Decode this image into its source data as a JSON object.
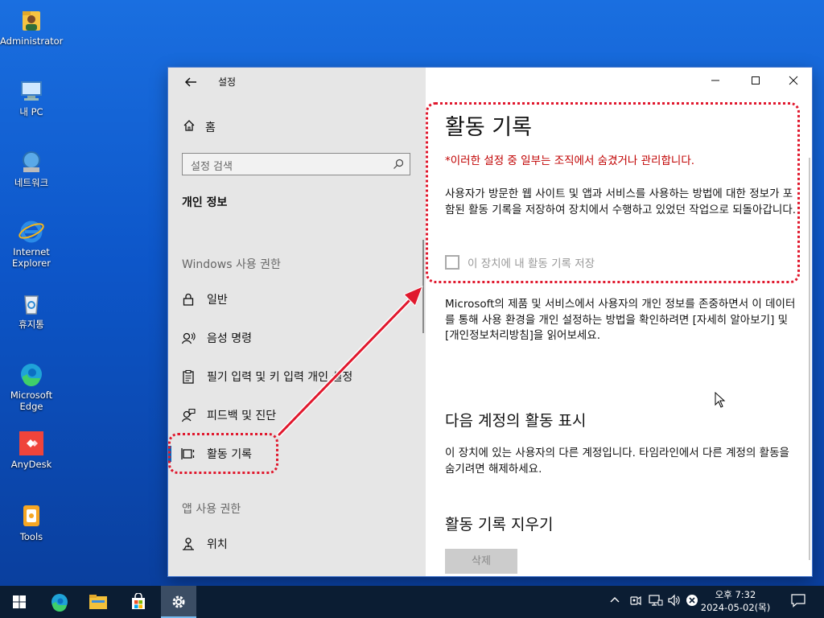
{
  "desktop": {
    "icons": [
      {
        "label": "Administrator",
        "icon": "user-folder-icon"
      },
      {
        "label": "내 PC",
        "icon": "computer-icon"
      },
      {
        "label": "네트워크",
        "icon": "network-icon"
      },
      {
        "label": "Internet Explorer",
        "icon": "internet-explorer-icon"
      },
      {
        "label": "휴지통",
        "icon": "recycle-bin-icon"
      },
      {
        "label": "Microsoft Edge",
        "icon": "edge-icon"
      },
      {
        "label": "AnyDesk",
        "icon": "anydesk-icon"
      },
      {
        "label": "Tools",
        "icon": "tools-icon"
      }
    ]
  },
  "window": {
    "title": "설정",
    "sidebar": {
      "home": "홈",
      "search_placeholder": "설정 검색",
      "section": "개인 정보",
      "group_windows": "Windows 사용 권한",
      "items": [
        {
          "label": "일반",
          "icon": "lock-icon"
        },
        {
          "label": "음성 명령",
          "icon": "speech-icon"
        },
        {
          "label": "필기 입력 및 키 입력 개인 설정",
          "icon": "clipboard-icon"
        },
        {
          "label": "피드백 및 진단",
          "icon": "feedback-icon"
        },
        {
          "label": "활동 기록",
          "icon": "activity-icon",
          "selected": true
        }
      ],
      "group_app": "앱 사용 권한",
      "items_app": [
        {
          "label": "위치",
          "icon": "location-icon"
        }
      ]
    },
    "content": {
      "title": "활동 기록",
      "managed_notice": "*이러한 설정 중 일부는 조직에서 숨겼거나 관리합니다.",
      "description": "사용자가 방문한 웹 사이트 및 앱과 서비스를 사용하는 방법에 대한 정보가 포함된 활동 기록을 저장하여 장치에서 수행하고 있었던 작업으로 되돌아갑니다.",
      "checkbox_label": "이 장치에 내 활동 기록 저장",
      "privacy_text": "Microsoft의 제품 및 서비스에서 사용자의 개인 정보를 존중하면서 이 데이터를 통해 사용 환경을 개인 설정하는 방법을 확인하려면 [자세히 알아보기] 및 [개인정보처리방침]을 읽어보세요.",
      "accounts_title": "다음 계정의 활동 표시",
      "accounts_text": "이 장치에 있는 사용자의 다른 계정입니다. 타임라인에서 다른 계정의 활동을 숨기려면 해제하세요.",
      "clear_title": "활동 기록 지우기",
      "clear_button": "삭제"
    }
  },
  "taskbar": {
    "clock_time": "오후 7:32",
    "clock_date": "2024-05-02(목)",
    "accent": "#e0182d"
  }
}
